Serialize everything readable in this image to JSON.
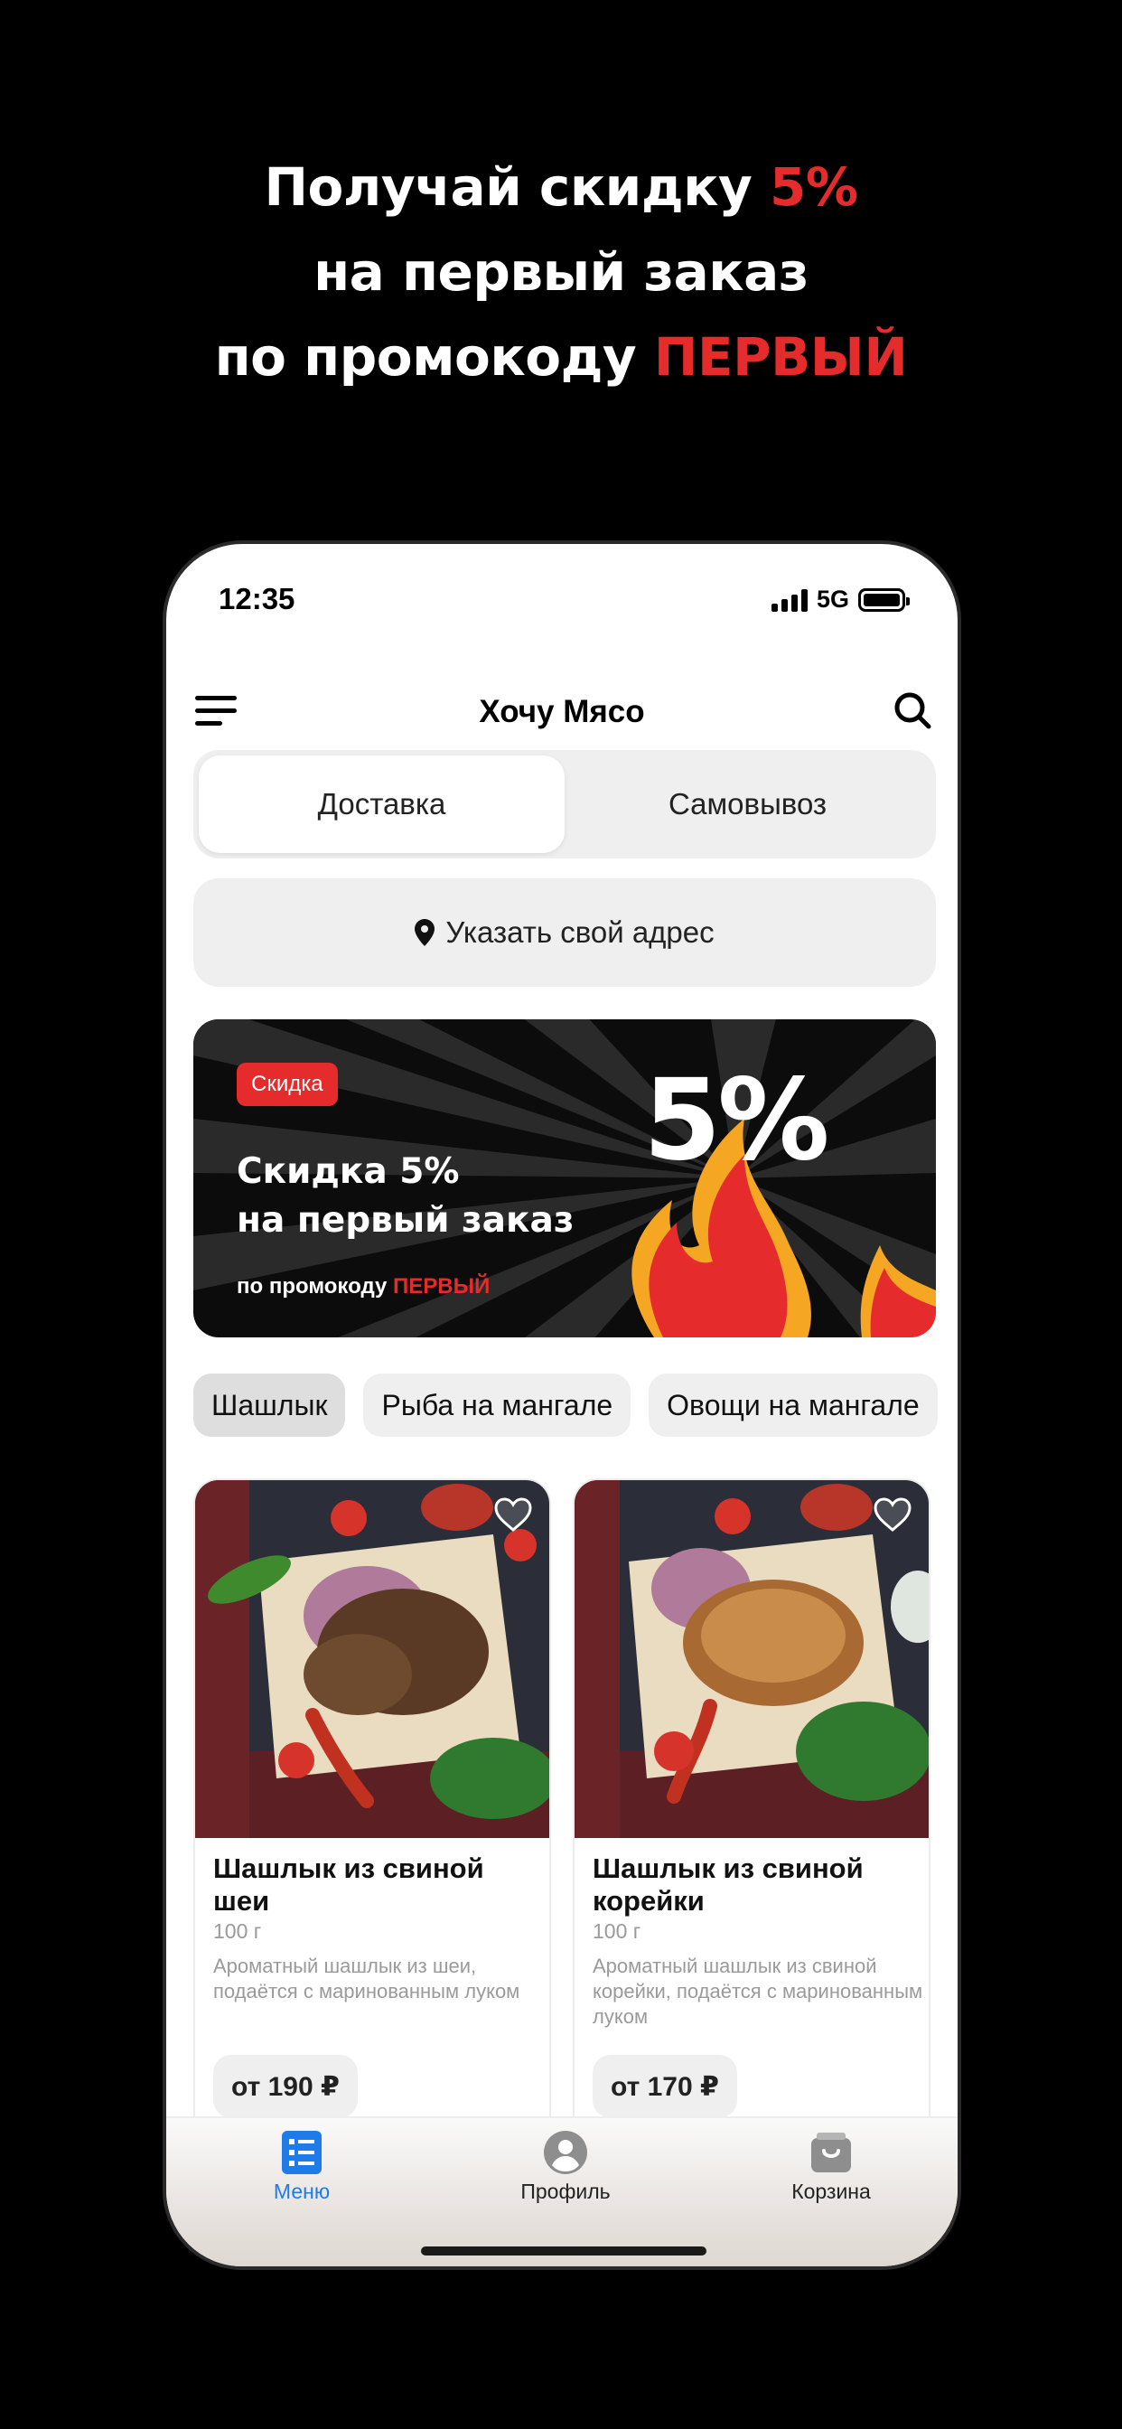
{
  "promo_header": {
    "line1_prefix": "Получай скидку ",
    "line1_highlight": "5%",
    "line2": "на первый заказ",
    "line3_prefix": "по промокоду ",
    "line3_highlight": "ПЕРВЫЙ"
  },
  "status_bar": {
    "time": "12:35",
    "network": "5G",
    "battery_level": 1.0,
    "signal_bars": 4
  },
  "header": {
    "title": "Хочу Мясо",
    "menu_icon": "hamburger-icon",
    "search_icon": "search-icon"
  },
  "delivery_mode": {
    "options": [
      "Доставка",
      "Самовывоз"
    ],
    "selected": "Доставка"
  },
  "address": {
    "label": "Указать свой адрес",
    "icon": "location-pin-icon"
  },
  "banner": {
    "badge": "Скидка",
    "title_line1": "Скидка 5%",
    "title_line2": "на первый заказ",
    "subtitle_prefix": "по промокоду ",
    "subtitle_code": "ПЕРВЫЙ",
    "big_text": "5%"
  },
  "categories": [
    {
      "label": "Шашлык",
      "active": true
    },
    {
      "label": "Рыба на мангале",
      "active": false
    },
    {
      "label": "Овощи на мангале",
      "active": false
    }
  ],
  "products": [
    {
      "title": "Шашлык из свиной шеи",
      "weight": "100 г",
      "description": "Ароматный шашлык из шеи, подаётся с маринованным луком",
      "price": "от 190 ₽",
      "favorite": false
    },
    {
      "title": "Шашлык из свиной корейки",
      "weight": "100 г",
      "description": "Ароматный шашлык из свиной корейки, подаётся с маринованным луком",
      "price": "от 170 ₽",
      "favorite": false
    }
  ],
  "tabbar": {
    "items": [
      {
        "label": "Меню",
        "icon": "menu-list-icon",
        "active": true
      },
      {
        "label": "Профиль",
        "icon": "profile-icon",
        "active": false
      },
      {
        "label": "Корзина",
        "icon": "cart-icon",
        "active": false
      }
    ]
  },
  "colors": {
    "accent_red": "#e52b2b",
    "active_tab_blue": "#1f7aea",
    "chip_bg": "#efefef"
  }
}
